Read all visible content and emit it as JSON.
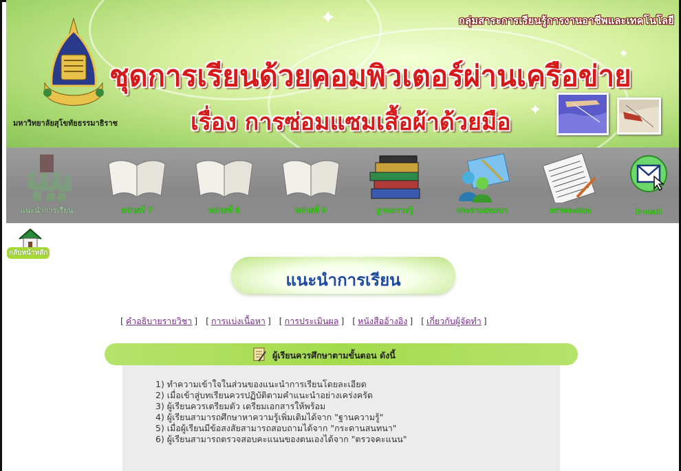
{
  "banner": {
    "group_title": "กลุ่มสาระการเรียนรู้การงานอาชีพและเทคโนโลยี",
    "main_title": "ชุดการเรียนด้วยคอมพิวเตอร์ผ่านเครือข่าย",
    "sub_title": "เรื่อง การซ่อมแซมเสื้อผ้าด้วยมือ",
    "university": "มหาวิทยาลัยสุโขทัยธรรมาธิราช"
  },
  "nav": {
    "items": [
      {
        "label": "แนะนำการเรียน",
        "icon": "people-icon"
      },
      {
        "label": "หน่วยที่ 7",
        "icon": "open-book-icon"
      },
      {
        "label": "หน่วยที่ 8",
        "icon": "open-book-icon"
      },
      {
        "label": "หน่วยที่ 9",
        "icon": "open-book-icon"
      },
      {
        "label": "ฐานความรู้",
        "icon": "book-stack-icon"
      },
      {
        "label": "กระดานสนทนา",
        "icon": "chat-users-icon"
      },
      {
        "label": "ตรวจคะแนน",
        "icon": "answer-sheet-icon"
      },
      {
        "label": "E-mail",
        "icon": "envelope-icon"
      }
    ]
  },
  "home": {
    "label": "กลับหน้าหลัก",
    "icon": "home-icon"
  },
  "section": {
    "heading": "แนะนำการเรียน"
  },
  "links": [
    "คำอธิบายรายวิชา",
    "การแบ่งเนื้อหา",
    "การประเมินผล",
    "หนังสืออ้างอิง",
    "เกี่ยวกับผู้จัดทำ"
  ],
  "steps": {
    "title": "ผู้เรียนควรศึกษาตามขั้นตอน ดังนี้",
    "items": [
      "1) ทำความเข้าใจในส่วนของแนะนำการเรียนโดยละเอียด",
      "2) เมื่อเข้าสู่บทเรียนควรปฏิบัติตามคำแนะนำอย่างเคร่งครัด",
      "3) ผู้เรียนควรเตรียมตัว เตรียมเอกสารให้พร้อม",
      "4) ผู้เรียนสามารถศึกษาหาความรู้เพิ่มเติมได้จาก \"ฐานความรู้\"",
      "5) เมื่อผู้เรียนมีข้อสงสัยสามารถสอบถามได้จาก \"กระดานสนทนา\"",
      "6) ผู้เรียนสามารถตรวจสอบคะแนนของตนเองได้จาก \"ตรวจคะแนน\""
    ]
  },
  "colors": {
    "title_red": "#d61a1a",
    "nav_label_green": "#3bd61a",
    "heading_blue": "#1f4aa0",
    "link_purple": "#7a2a8a",
    "header_green": "#a4db4d"
  }
}
